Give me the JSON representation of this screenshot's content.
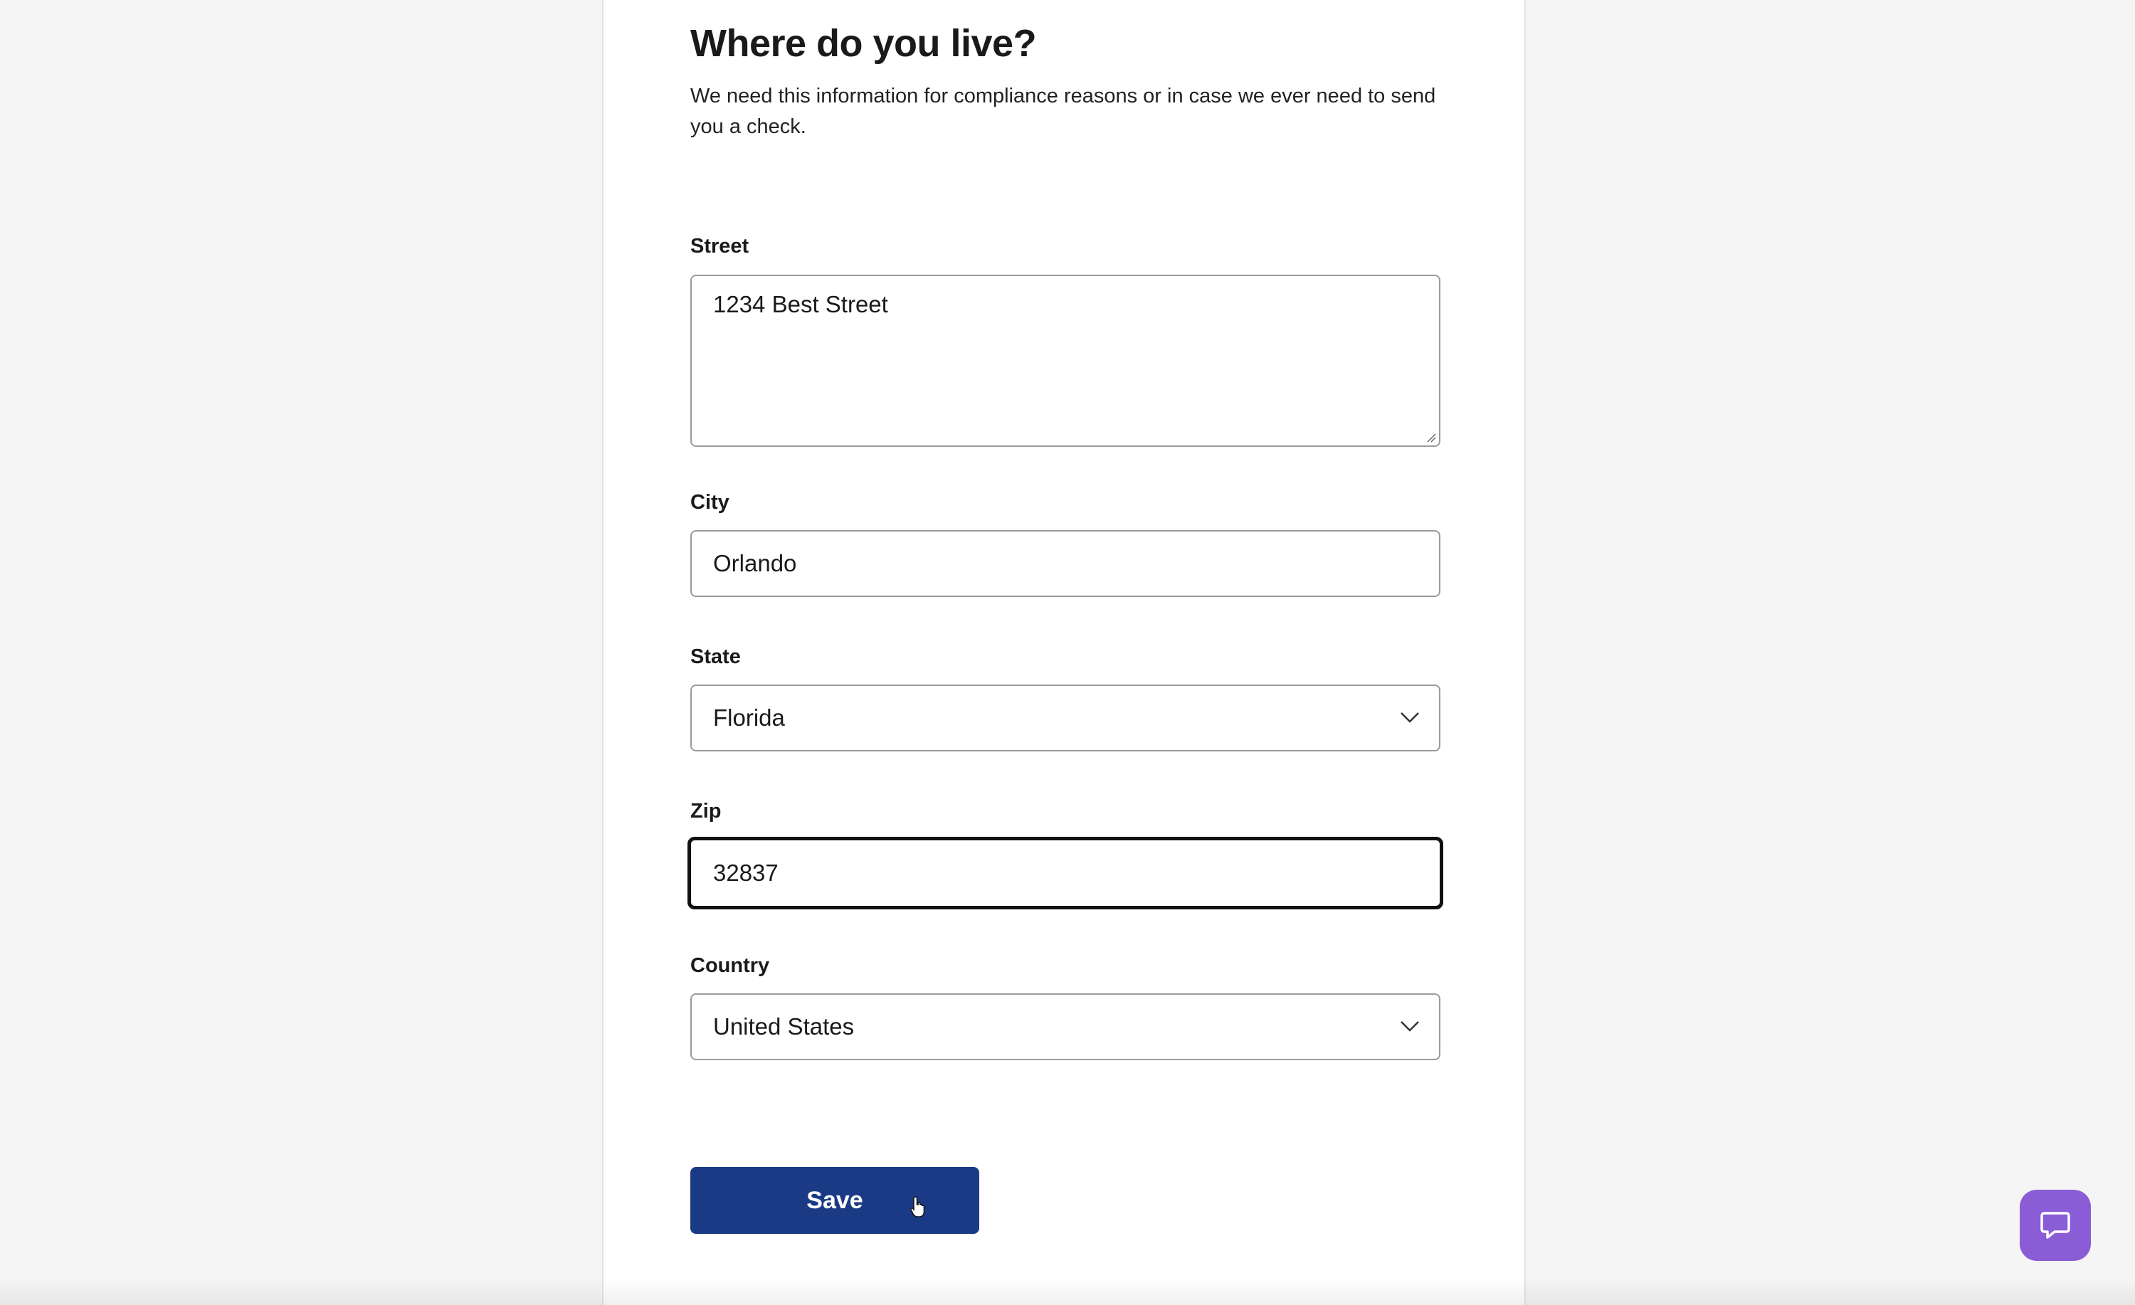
{
  "form": {
    "title": "Where do you live?",
    "subtitle": "We need this information for compliance reasons or in case we ever need to send you a check.",
    "fields": {
      "street": {
        "label": "Street",
        "value": "1234 Best Street"
      },
      "city": {
        "label": "City",
        "value": "Orlando"
      },
      "state": {
        "label": "State",
        "value": "Florida"
      },
      "zip": {
        "label": "Zip",
        "value": "32837"
      },
      "country": {
        "label": "Country",
        "value": "United States"
      }
    },
    "save_label": "Save"
  },
  "icons": {
    "select": "chevron-down-icon",
    "help": "chat-bubble-icon",
    "cursor": "pointer-hand-icon"
  },
  "colors": {
    "background": "#f5f5f5",
    "panel": "#ffffff",
    "primary_button": "#1b3a85",
    "help_button": "#8a5cd6",
    "focused_border": "#111111"
  }
}
